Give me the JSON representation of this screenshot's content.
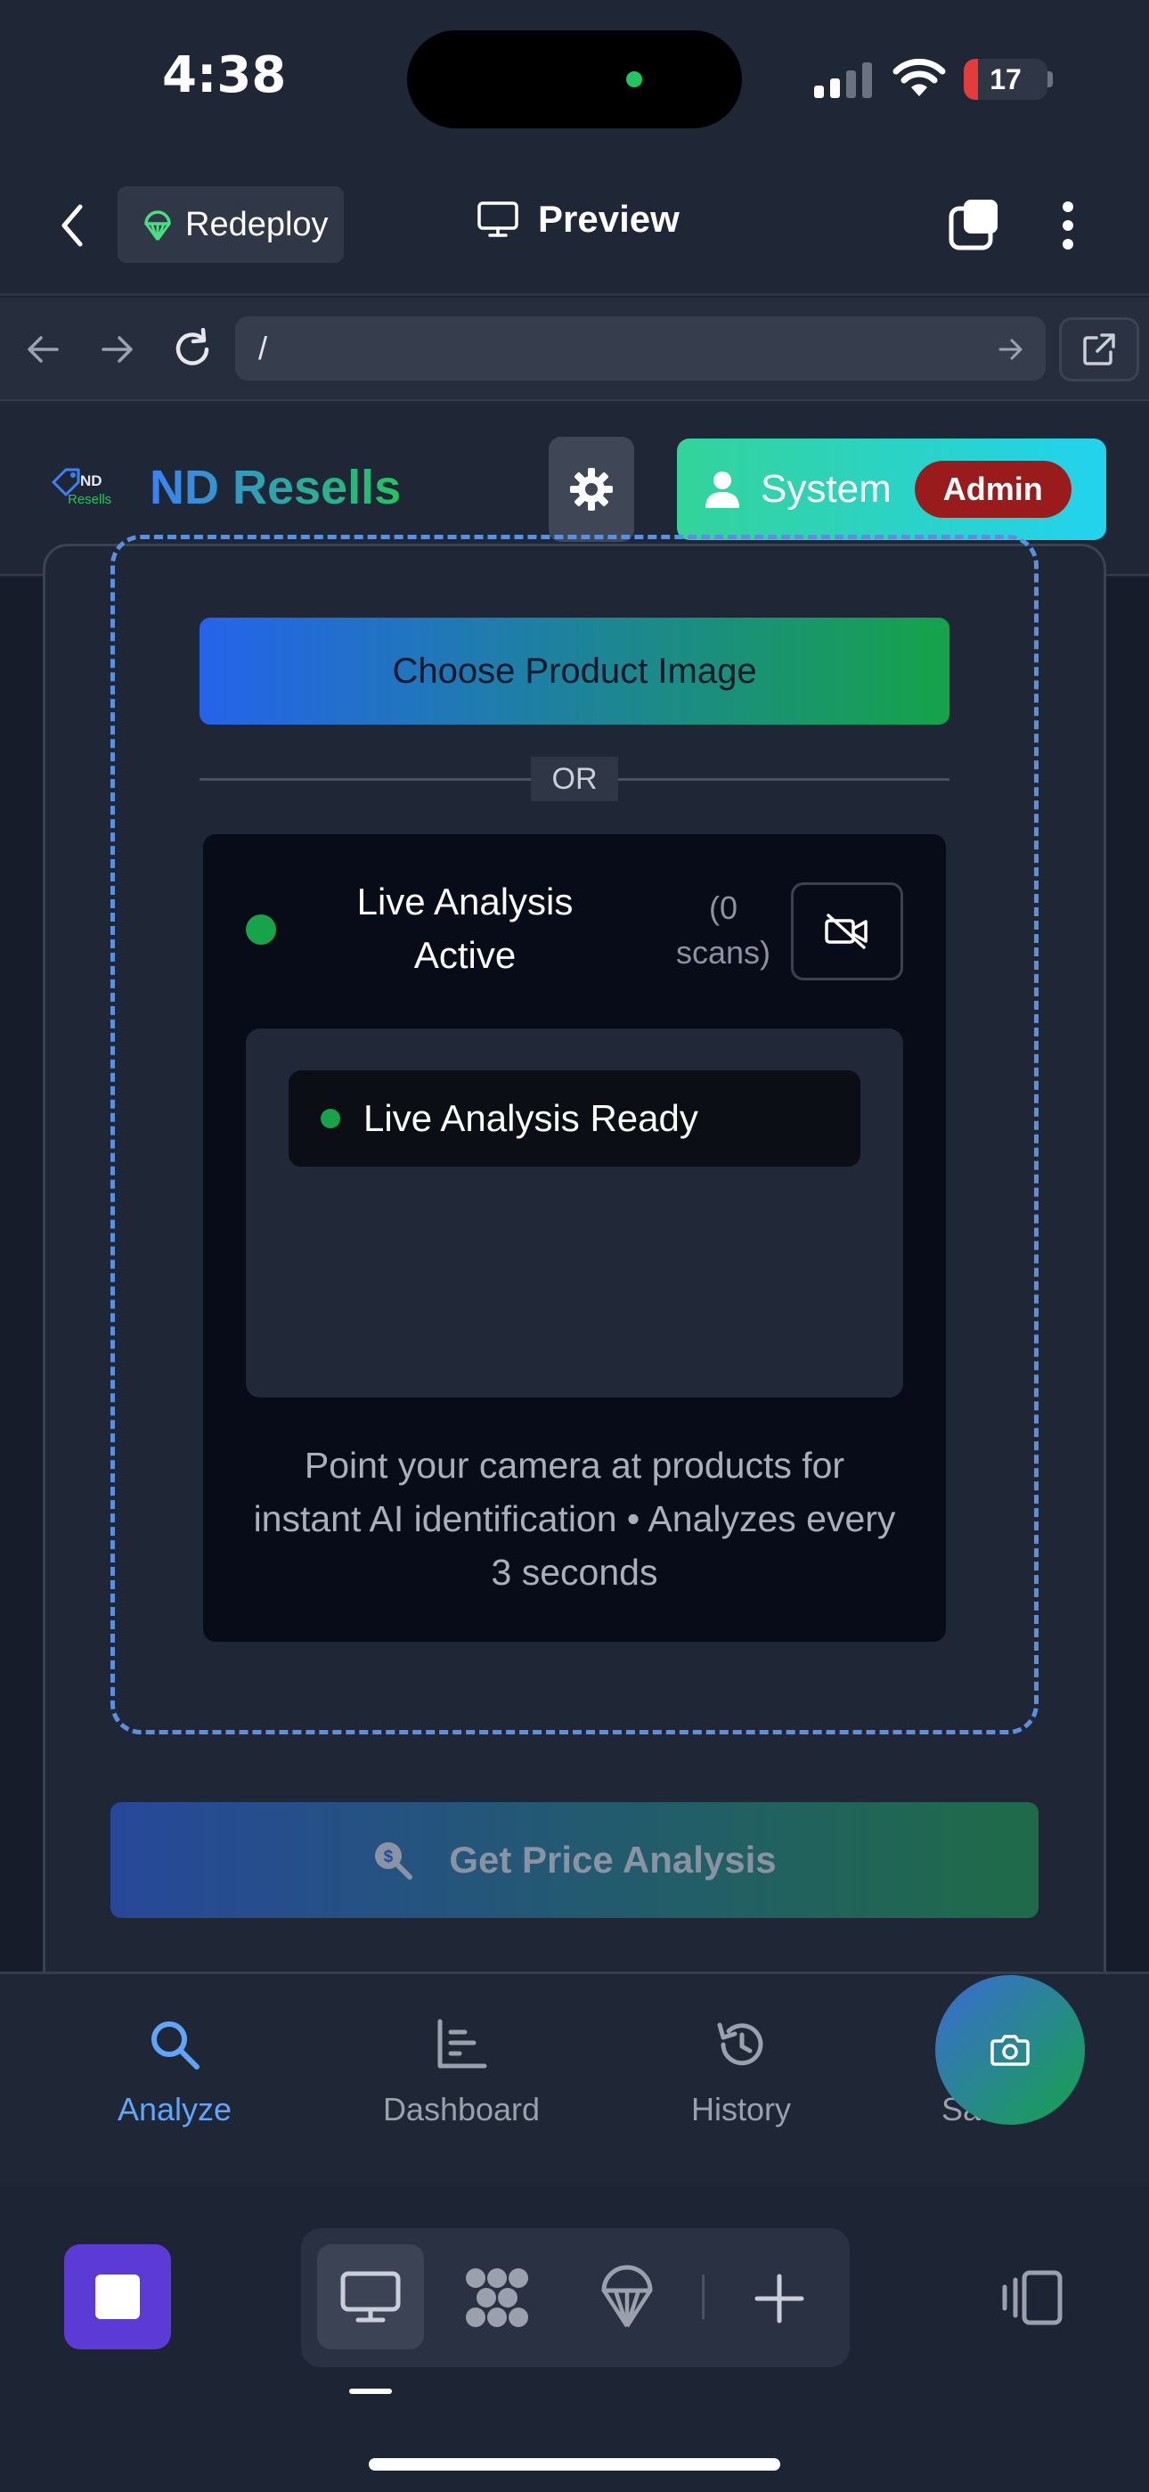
{
  "status_bar": {
    "time": "4:38",
    "battery": "17",
    "battery_level": 0.17
  },
  "preview_header": {
    "redeploy_label": "Redeploy",
    "title": "Preview"
  },
  "url_bar": {
    "url": "/"
  },
  "app_header": {
    "logo_text_top": "ND",
    "logo_text_bottom": "Resells",
    "brand": "ND Resells",
    "user_name": "System",
    "role_badge": "Admin"
  },
  "upload": {
    "choose_label": "Choose Product Image",
    "or_label": "OR"
  },
  "live": {
    "title": "Live Analysis Active",
    "scan_count": "(0 scans)",
    "ready_label": "Live Analysis Ready",
    "hint": "Point your camera at products for instant AI identification • Analyzes every 3 seconds"
  },
  "price_button": {
    "label": "Get Price Analysis"
  },
  "bottom_nav": {
    "items": [
      {
        "label": "Analyze",
        "icon": "search-icon",
        "active": true
      },
      {
        "label": "Dashboard",
        "icon": "bar-chart-icon",
        "active": false
      },
      {
        "label": "History",
        "icon": "history-icon",
        "active": false
      },
      {
        "label": "Saved",
        "icon": "bookmark-icon",
        "active": false
      }
    ]
  },
  "colors": {
    "accent_blue": "#60a5fa",
    "brand_green": "#22c55e",
    "admin_red": "#991b1b",
    "ide_purple": "#5b3ad6"
  }
}
